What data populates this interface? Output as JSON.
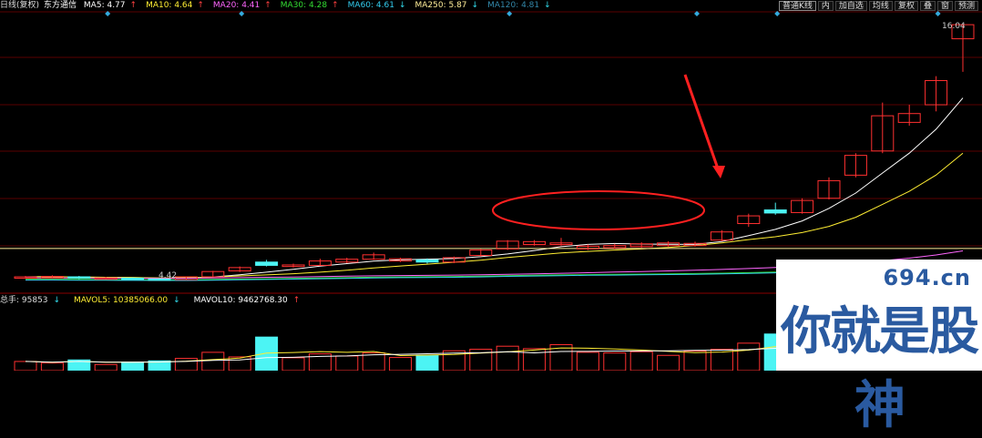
{
  "header": {
    "period": "日线(复权)",
    "stock_name": "东方通信",
    "ma": [
      {
        "label": "MA5: 4.77",
        "color": "#ffffff",
        "dir": "up"
      },
      {
        "label": "MA10: 4.64",
        "color": "#ffee33",
        "dir": "up"
      },
      {
        "label": "MA20: 4.41",
        "color": "#ff66ff",
        "dir": "up"
      },
      {
        "label": "MA30: 4.28",
        "color": "#33dd33",
        "dir": "up"
      },
      {
        "label": "MA60: 4.61",
        "color": "#33ccee",
        "dir": "down"
      },
      {
        "label": "MA250: 5.87",
        "color": "#ffee99",
        "dir": "down"
      },
      {
        "label": "MA120: 4.81",
        "color": "#3388aa",
        "dir": "down"
      }
    ]
  },
  "toolbar": {
    "items": [
      "普通K线",
      "内",
      "加自选",
      "均线",
      "复权",
      "叠",
      "窗",
      "预测"
    ]
  },
  "price_labels": {
    "high": "16.04",
    "low": "4.42"
  },
  "volume_header": {
    "total": {
      "label": "总手: 95853",
      "dir": "down"
    },
    "mavol5": {
      "label": "MAVOL5: 10385066.00",
      "dir": "down"
    },
    "mavol10": {
      "label": "MAVOL10: 9462768.30",
      "dir": "up"
    }
  },
  "watermark": {
    "url": "694.cn",
    "text": "你就是股神"
  },
  "chart_data": {
    "type": "candlestick",
    "price_range": [
      4.0,
      16.5
    ],
    "candles": [
      {
        "o": 4.55,
        "c": 4.58,
        "h": 4.62,
        "l": 4.5,
        "v": 3.0
      },
      {
        "o": 4.55,
        "c": 4.6,
        "h": 4.65,
        "l": 4.52,
        "v": 2.5
      },
      {
        "o": 4.58,
        "c": 4.52,
        "h": 4.62,
        "l": 4.48,
        "v": 3.5
      },
      {
        "o": 4.52,
        "c": 4.53,
        "h": 4.58,
        "l": 4.48,
        "v": 2.0
      },
      {
        "o": 4.52,
        "c": 4.5,
        "h": 4.55,
        "l": 4.46,
        "v": 2.8
      },
      {
        "o": 4.48,
        "c": 4.45,
        "h": 4.52,
        "l": 4.42,
        "v": 3.2
      },
      {
        "o": 4.45,
        "c": 4.58,
        "h": 4.6,
        "l": 4.43,
        "v": 4.0
      },
      {
        "o": 4.58,
        "c": 4.82,
        "h": 4.85,
        "l": 4.56,
        "v": 6.0
      },
      {
        "o": 4.85,
        "c": 5.0,
        "h": 5.05,
        "l": 4.8,
        "v": 4.5
      },
      {
        "o": 5.25,
        "c": 5.1,
        "h": 5.35,
        "l": 5.05,
        "v": 11.0
      },
      {
        "o": 5.05,
        "c": 5.12,
        "h": 5.18,
        "l": 5.0,
        "v": 4.2
      },
      {
        "o": 5.1,
        "c": 5.3,
        "h": 5.4,
        "l": 5.08,
        "v": 5.5
      },
      {
        "o": 5.25,
        "c": 5.38,
        "h": 5.45,
        "l": 5.2,
        "v": 4.8
      },
      {
        "o": 5.38,
        "c": 5.58,
        "h": 5.68,
        "l": 5.35,
        "v": 5.8
      },
      {
        "o": 5.3,
        "c": 5.4,
        "h": 5.45,
        "l": 5.25,
        "v": 4.3
      },
      {
        "o": 5.35,
        "c": 5.25,
        "h": 5.42,
        "l": 5.18,
        "v": 5.0
      },
      {
        "o": 5.25,
        "c": 5.45,
        "h": 5.5,
        "l": 5.2,
        "v": 6.5
      },
      {
        "o": 5.55,
        "c": 5.8,
        "h": 5.85,
        "l": 5.5,
        "v": 7.0
      },
      {
        "o": 5.85,
        "c": 6.2,
        "h": 6.25,
        "l": 5.8,
        "v": 8.0
      },
      {
        "o": 6.05,
        "c": 6.18,
        "h": 6.25,
        "l": 6.0,
        "v": 7.2
      },
      {
        "o": 6.05,
        "c": 6.12,
        "h": 6.35,
        "l": 6.0,
        "v": 8.5
      },
      {
        "o": 5.85,
        "c": 5.97,
        "h": 6.05,
        "l": 5.8,
        "v": 6.0
      },
      {
        "o": 5.9,
        "c": 6.0,
        "h": 6.08,
        "l": 5.85,
        "v": 5.8
      },
      {
        "o": 5.95,
        "c": 6.08,
        "h": 6.15,
        "l": 5.9,
        "v": 6.2
      },
      {
        "o": 6.0,
        "c": 6.12,
        "h": 6.2,
        "l": 5.95,
        "v": 5.0
      },
      {
        "o": 6.0,
        "c": 6.1,
        "h": 6.18,
        "l": 5.95,
        "v": 6.4
      },
      {
        "o": 6.25,
        "c": 6.62,
        "h": 6.7,
        "l": 6.2,
        "v": 7.0
      },
      {
        "o": 7.0,
        "c": 7.35,
        "h": 7.45,
        "l": 6.85,
        "v": 9.0
      },
      {
        "o": 7.62,
        "c": 7.48,
        "h": 7.95,
        "l": 7.4,
        "v": 12.0
      },
      {
        "o": 7.5,
        "c": 8.05,
        "h": 8.15,
        "l": 7.45,
        "v": 11.0
      },
      {
        "o": 8.15,
        "c": 8.95,
        "h": 9.1,
        "l": 8.1,
        "v": 14.0
      },
      {
        "o": 9.2,
        "c": 10.1,
        "h": 10.2,
        "l": 9.1,
        "v": 16.0
      },
      {
        "o": 10.3,
        "c": 11.9,
        "h": 12.5,
        "l": 10.2,
        "v": 18.0
      },
      {
        "o": 11.6,
        "c": 12.0,
        "h": 12.4,
        "l": 11.45,
        "v": 15.0
      },
      {
        "o": 12.4,
        "c": 13.5,
        "h": 13.7,
        "l": 12.1,
        "v": 17.0
      },
      {
        "o": 15.4,
        "c": 16.04,
        "h": 16.04,
        "l": 13.9,
        "v": 20.0
      }
    ]
  },
  "colors": {
    "up": "#ff3030",
    "down": "#4cf4f4",
    "grid": "#5a0000",
    "annotation": "#ff2020"
  }
}
